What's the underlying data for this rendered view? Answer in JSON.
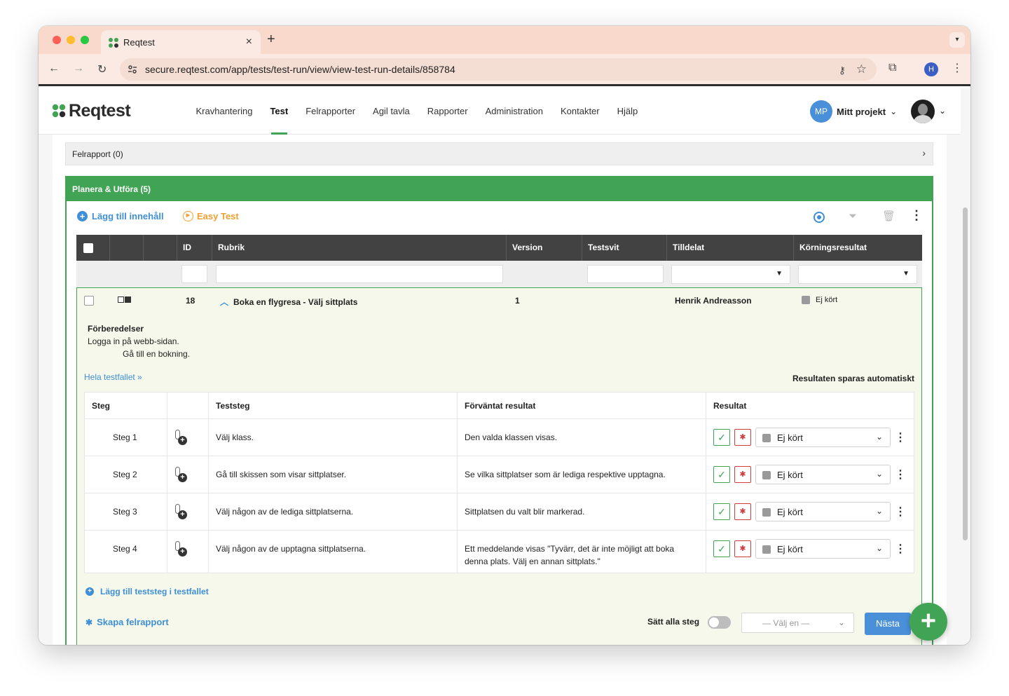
{
  "browser": {
    "tab_title": "Reqtest",
    "url": "secure.reqtest.com/app/tests/test-run/view/view-test-run-details/858784",
    "profile_initial": "H"
  },
  "header": {
    "logo_text": "Reqtest",
    "nav": [
      "Kravhantering",
      "Test",
      "Felrapporter",
      "Agil tavla",
      "Rapporter",
      "Administration",
      "Kontakter",
      "Hjälp"
    ],
    "active_nav": "Test",
    "project_initials": "MP",
    "project_name": "Mitt projekt"
  },
  "bug_section": {
    "label": "Felrapport (0)"
  },
  "plan": {
    "title": "Planera & Utföra (5)",
    "toolbar": {
      "add_content": "Lägg till innehåll",
      "easy_test": "Easy Test"
    },
    "columns": [
      "ID",
      "Rubrik",
      "Version",
      "Testsvit",
      "Tilldelat",
      "Körningsresultat"
    ],
    "row": {
      "id": "18",
      "title": "Boka en flygresa - Välj sittplats",
      "version": "1",
      "assignee": "Henrik Andreasson",
      "result": "Ej kört"
    },
    "preparations": {
      "heading": "Förberedelser",
      "lines": [
        "Logga in på webb-sidan.",
        "Gå till en bokning."
      ]
    },
    "full_testcase_link": "Hela testfallet »",
    "autosave_note": "Resultaten sparas automatiskt",
    "steps_columns": [
      "Steg",
      "Teststeg",
      "Förväntat resultat",
      "Resultat"
    ],
    "steps": [
      {
        "label": "Steg 1",
        "action": "Välj klass.",
        "expected": "Den valda klassen visas.",
        "result": "Ej kört"
      },
      {
        "label": "Steg 2",
        "action": "Gå till skissen som visar sittplatser.",
        "expected": "Se vilka sittplatser som är lediga respektive upptagna.",
        "result": "Ej kört"
      },
      {
        "label": "Steg 3",
        "action": "Välj någon av de lediga sittplatserna.",
        "expected": "Sittplatsen du valt blir markerad.",
        "result": "Ej kört"
      },
      {
        "label": "Steg 4",
        "action": "Välj någon av de upptagna sittplatserna.",
        "expected": "Ett meddelande visas \"Tyvärr, det är inte möjligt att boka denna plats. Välj en annan sittplats.\"",
        "result": "Ej kört"
      }
    ],
    "add_step_label": "Lägg till teststeg i testfallet",
    "create_bug_label": "Skapa felrapport",
    "set_all_label": "Sätt alla steg",
    "choose_placeholder": "— Välj en —",
    "next_label": "Nästa"
  },
  "colors": {
    "brand_green": "#41a455",
    "link_blue": "#3f8fd6",
    "easy_test_orange": "#f0a030",
    "fail_red": "#d23c3c"
  },
  "icons": {
    "fab": "plus-icon",
    "step_attach": "paperclip-plus-icon",
    "pass": "check-icon",
    "fail": "bug-icon"
  }
}
